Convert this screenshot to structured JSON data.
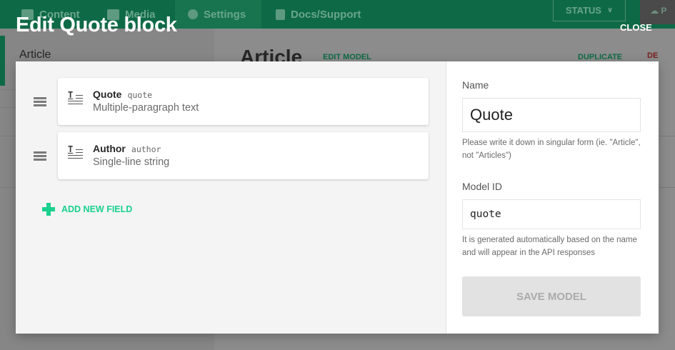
{
  "app": {
    "nav": [
      {
        "label": "Content"
      },
      {
        "label": "Media"
      },
      {
        "label": "Settings"
      },
      {
        "label": "Docs/Support"
      }
    ],
    "status_label": "STATUS",
    "publish_label": "P",
    "sidebar_title": "Article",
    "main_title": "Article",
    "edit_model_label": "EDIT MODEL",
    "duplicate_label": "DUPLICATE",
    "delete_label": "DE"
  },
  "modal": {
    "title": "Edit Quote block",
    "close_label": "CLOSE",
    "fields": [
      {
        "name": "Quote",
        "api_key": "quote",
        "type": "Multiple-paragraph text",
        "icon": "text-field-icon"
      },
      {
        "name": "Author",
        "api_key": "author",
        "type": "Single-line string",
        "icon": "text-field-icon"
      }
    ],
    "add_field_label": "ADD NEW FIELD",
    "name_label": "Name",
    "name_value": "Quote",
    "name_hint": "Please write it down in singular form (ie. \"Article\", not \"Articles\")",
    "model_id_label": "Model ID",
    "model_id_value": "quote",
    "model_id_hint": "It is generated automatically based on the name and will appear in the API responses",
    "save_label": "SAVE MODEL"
  },
  "colors": {
    "brand_green": "#0e6a46",
    "accent_green": "#1ad18f",
    "disabled_button": "#e2e2e2"
  }
}
